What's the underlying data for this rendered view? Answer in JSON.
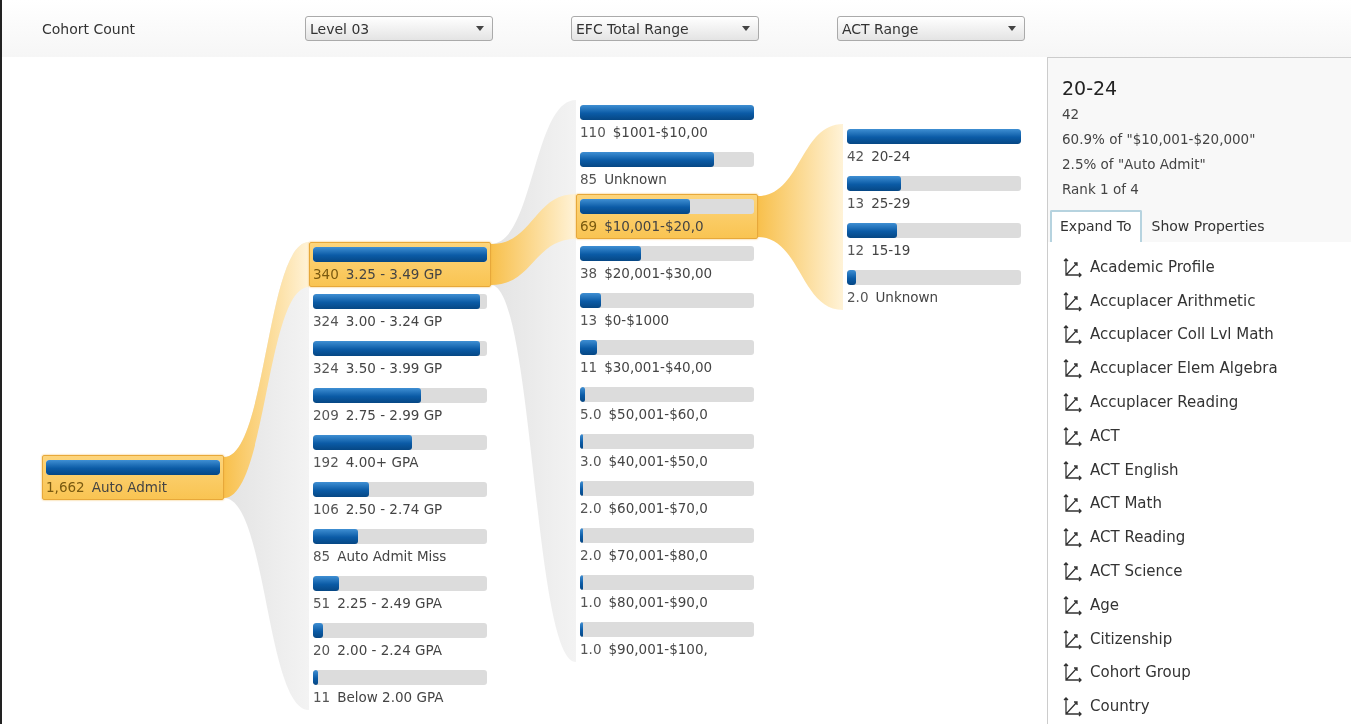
{
  "toolbar": {
    "measure": "Cohort Count",
    "dropdowns": [
      "Level 03",
      "EFC Total Range",
      "ACT Range"
    ]
  },
  "tree": {
    "columns": [
      {
        "nodes": [
          {
            "count": "1,662",
            "label": "Auto Admit",
            "level": 1,
            "selected": true
          }
        ]
      },
      {
        "nodes": [
          {
            "count": "340",
            "label": "3.25 - 3.49 GP",
            "level": 1,
            "selected": true
          },
          {
            "count": "324",
            "label": "3.00 - 3.24 GP",
            "level": 0.96,
            "selected": false
          },
          {
            "count": "324",
            "label": "3.50 - 3.99 GP",
            "level": 0.96,
            "selected": false
          },
          {
            "count": "209",
            "label": "2.75 - 2.99 GP",
            "level": 0.62,
            "selected": false
          },
          {
            "count": "192",
            "label": "4.00+ GPA",
            "level": 0.57,
            "selected": false
          },
          {
            "count": "106",
            "label": "2.50 - 2.74 GP",
            "level": 0.32,
            "selected": false
          },
          {
            "count": "85",
            "label": "Auto Admit Miss",
            "level": 0.26,
            "selected": false
          },
          {
            "count": "51",
            "label": "2.25 - 2.49 GPA",
            "level": 0.15,
            "selected": false
          },
          {
            "count": "20",
            "label": "2.00 - 2.24 GPA",
            "level": 0.06,
            "selected": false
          },
          {
            "count": "11",
            "label": "Below 2.00 GPA",
            "level": 0.03,
            "selected": false
          }
        ]
      },
      {
        "nodes": [
          {
            "count": "110",
            "label": "$1001-$10,00",
            "level": 1,
            "selected": false
          },
          {
            "count": "85",
            "label": "Unknown",
            "level": 0.77,
            "selected": false
          },
          {
            "count": "69",
            "label": "$10,001-$20,0",
            "level": 0.63,
            "selected": true
          },
          {
            "count": "38",
            "label": "$20,001-$30,00",
            "level": 0.35,
            "selected": false
          },
          {
            "count": "13",
            "label": "$0-$1000",
            "level": 0.12,
            "selected": false
          },
          {
            "count": "11",
            "label": "$30,001-$40,00",
            "level": 0.1,
            "selected": false
          },
          {
            "count": "5.0",
            "label": "$50,001-$60,0",
            "level": 0.03,
            "selected": false
          },
          {
            "count": "3.0",
            "label": "$40,001-$50,0",
            "level": 0.02,
            "selected": false
          },
          {
            "count": "2.0",
            "label": "$60,001-$70,0",
            "level": 0.015,
            "selected": false
          },
          {
            "count": "2.0",
            "label": "$70,001-$80,0",
            "level": 0.015,
            "selected": false
          },
          {
            "count": "1.0",
            "label": "$80,001-$90,0",
            "level": 0.01,
            "selected": false
          },
          {
            "count": "1.0",
            "label": "$90,001-$100,",
            "level": 0.01,
            "selected": false
          }
        ]
      },
      {
        "nodes": [
          {
            "count": "42",
            "label": "20-24",
            "level": 1,
            "selected": false
          },
          {
            "count": "13",
            "label": "25-29",
            "level": 0.31,
            "selected": false
          },
          {
            "count": "12",
            "label": "15-19",
            "level": 0.29,
            "selected": false
          },
          {
            "count": "2.0",
            "label": "Unknown",
            "level": 0.05,
            "selected": false
          }
        ]
      }
    ]
  },
  "details": {
    "title": "20-24",
    "lines": [
      "42",
      "60.9% of \"$10,001-$20,000\"",
      "2.5% of \"Auto Admit\"",
      "Rank 1 of 4"
    ],
    "tabs": [
      {
        "label": "Expand To",
        "selected": true
      },
      {
        "label": "Show Properties",
        "selected": false
      }
    ],
    "expand_items": [
      "Academic Profile",
      "Accuplacer Arithmetic",
      "Accuplacer Coll Lvl Math",
      "Accuplacer Elem Algebra",
      "Accuplacer Reading",
      "ACT",
      "ACT English",
      "ACT Math",
      "ACT Reading",
      "ACT Science",
      "Age",
      "Citizenship",
      "Cohort Group",
      "Country"
    ]
  }
}
